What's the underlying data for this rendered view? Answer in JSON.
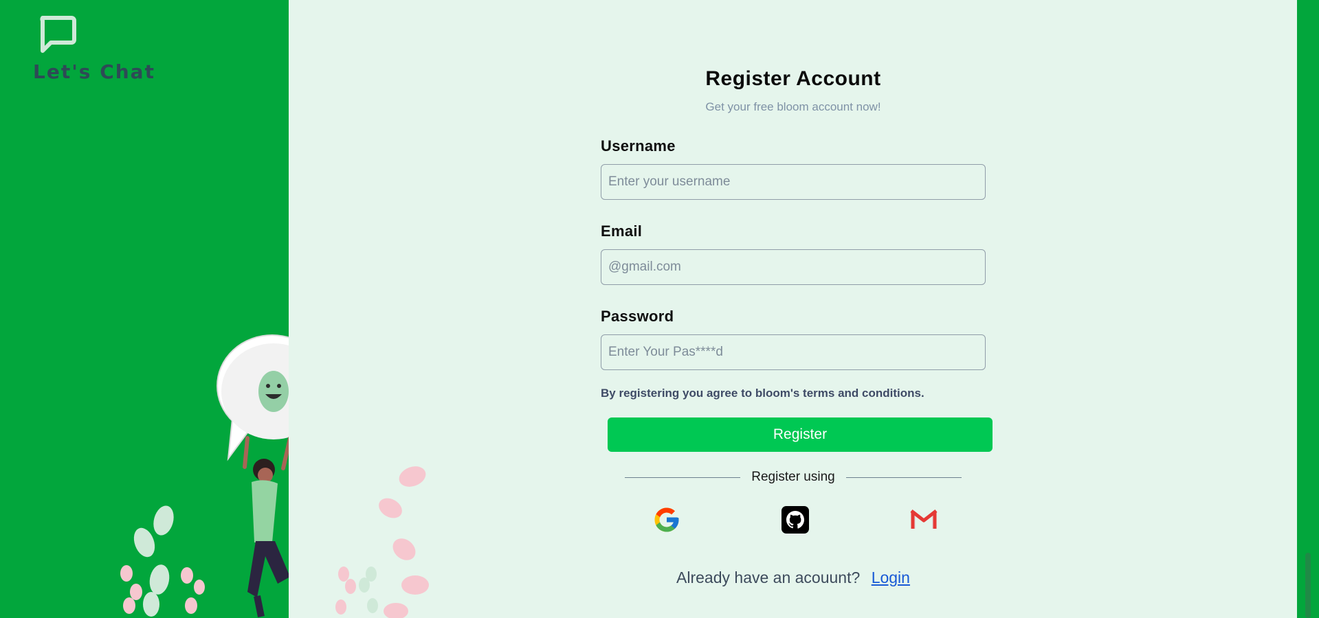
{
  "brand": {
    "name": "Let's Chat",
    "icon": "chat-bubble-icon"
  },
  "form": {
    "title": "Register Account",
    "subtitle": "Get your free bloom account now!",
    "username": {
      "label": "Username",
      "placeholder": "Enter your username",
      "value": ""
    },
    "email": {
      "label": "Email",
      "placeholder": "@gmail.com",
      "value": ""
    },
    "password": {
      "label": "Password",
      "placeholder": "Enter Your Pas****d",
      "value": ""
    },
    "terms": "By registering you agree to bloom's terms and conditions.",
    "register_label": "Register",
    "divider_text": "Register using",
    "social": [
      {
        "name": "Google",
        "icon": "google-icon"
      },
      {
        "name": "GitHub",
        "icon": "github-icon"
      },
      {
        "name": "Gmail",
        "icon": "gmail-icon"
      }
    ],
    "login_prompt": "Already have an acouunt?",
    "login_label": "Login"
  },
  "colors": {
    "sidebar": "#02a63c",
    "panel": "#e5f5ec",
    "button": "#00c853",
    "link": "#1859d6"
  }
}
